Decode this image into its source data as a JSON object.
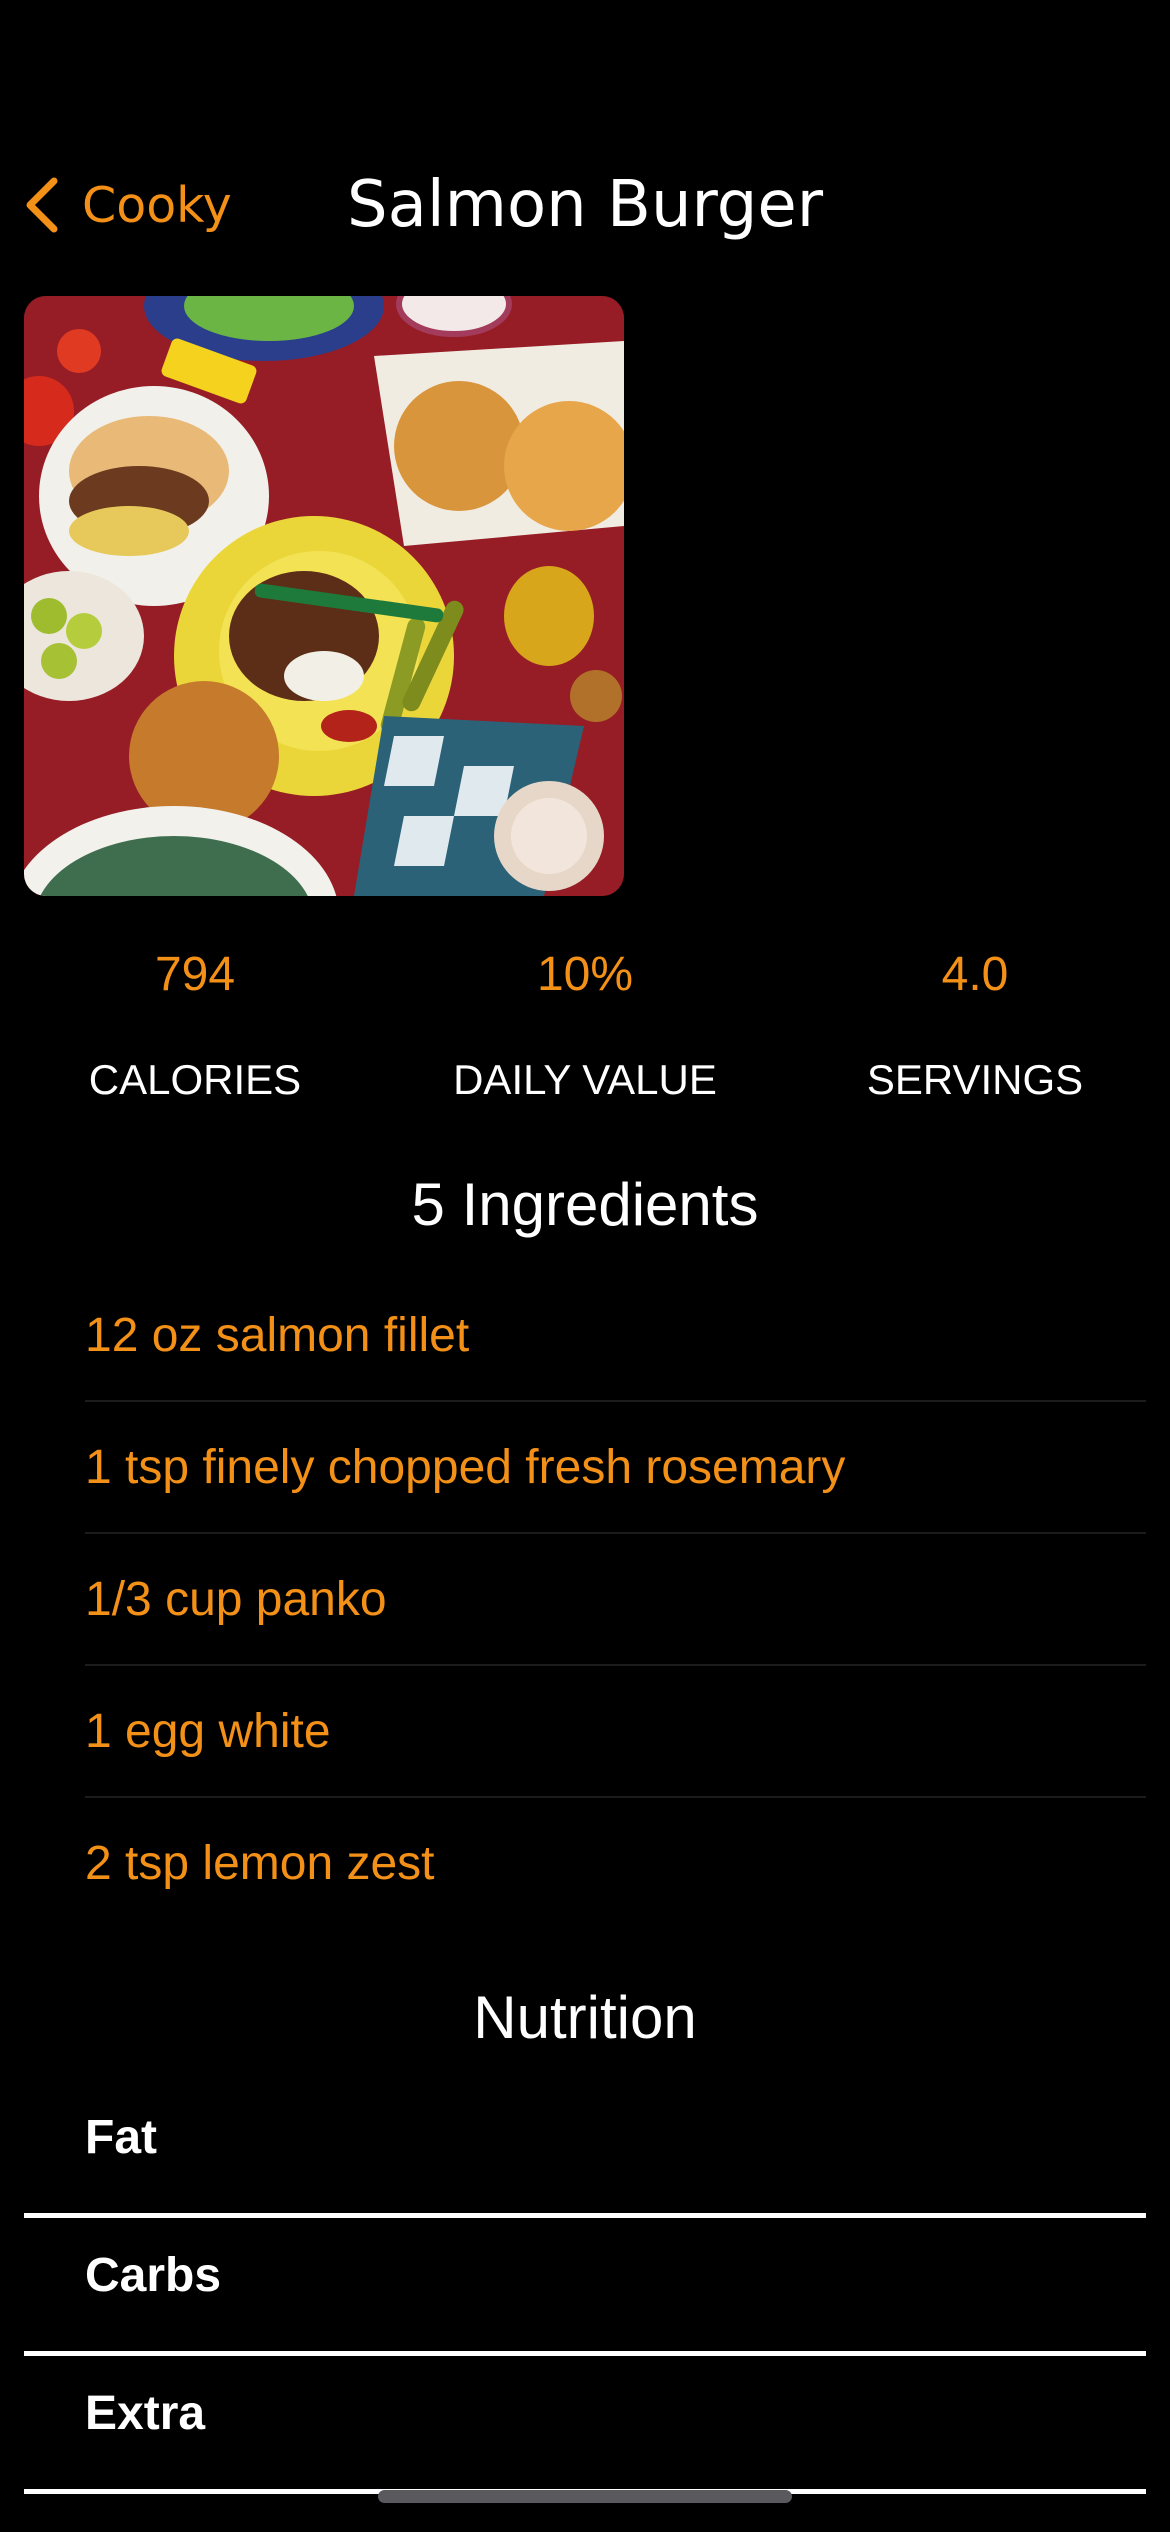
{
  "nav": {
    "back_label": "Cooky",
    "title": "Salmon Burger"
  },
  "photo": {
    "icon": "food-photo"
  },
  "stats": [
    {
      "value": "794",
      "label": "CALORIES"
    },
    {
      "value": "10%",
      "label": "DAILY VALUE"
    },
    {
      "value": "4.0",
      "label": "SERVINGS"
    }
  ],
  "ingredients": {
    "title": "5 Ingredients",
    "items": [
      "12 oz salmon fillet",
      "1 tsp finely chopped fresh rosemary",
      "1/3 cup panko",
      "1 egg white",
      "2 tsp lemon zest"
    ]
  },
  "nutrition": {
    "title": "Nutrition",
    "rows": [
      "Fat",
      "Carbs",
      "Extra"
    ]
  },
  "colors": {
    "accent": "#f39018",
    "background": "#000000",
    "text": "#ffffff"
  }
}
